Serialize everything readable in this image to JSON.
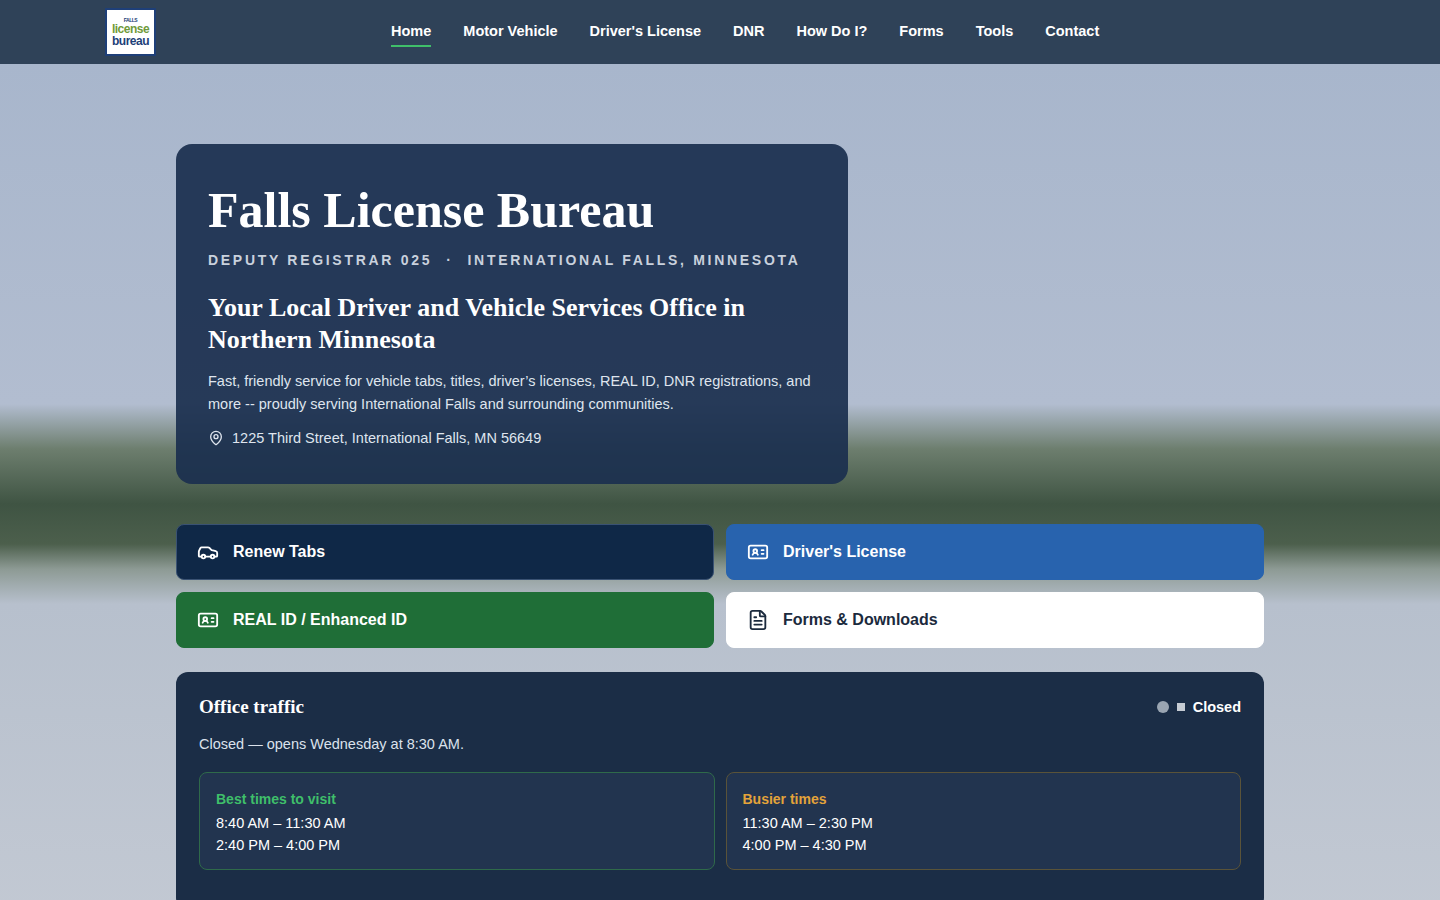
{
  "logo": {
    "lines": [
      "FALLS",
      "license",
      "bureau"
    ]
  },
  "nav": [
    {
      "label": "Home",
      "selected": true
    },
    {
      "label": "Motor Vehicle",
      "selected": false
    },
    {
      "label": "Driver's License",
      "selected": false
    },
    {
      "label": "DNR",
      "selected": false
    },
    {
      "label": "How Do I?",
      "selected": false
    },
    {
      "label": "Forms",
      "selected": false
    },
    {
      "label": "Tools",
      "selected": false
    },
    {
      "label": "Contact",
      "selected": false
    }
  ],
  "hero": {
    "title": "Falls License Bureau",
    "subtitle": [
      "DEPUTY REGISTRAR 025",
      "·",
      "INTERNATIONAL FALLS, MINNESOTA"
    ],
    "heading": "Your Local Driver and Vehicle Services Office in Northern Minnesota",
    "description": "Fast, friendly service for vehicle tabs, titles, driver’s licenses, REAL ID, DNR registrations, and more -- proudly serving International Falls and surrounding communities.",
    "address": "1225 Third Street, International Falls, MN 56649"
  },
  "actions": [
    {
      "label": "Renew Tabs",
      "kind": "dark"
    },
    {
      "label": "Driver's License",
      "kind": "blue"
    },
    {
      "label": "REAL ID / Enhanced ID",
      "kind": "green"
    },
    {
      "label": "Forms & Downloads",
      "kind": "light"
    }
  ],
  "traffic": {
    "title": "Office traffic",
    "status": "Closed",
    "open": false,
    "message": "Closed — opens Wednesday at 8:30 AM.",
    "windows": [
      {
        "label": "Best times to visit",
        "kind": "best",
        "times": [
          "8:40 AM – 11:30 AM",
          "2:40 PM – 4:00 PM"
        ]
      },
      {
        "label": "Busier times",
        "kind": "busy",
        "times": [
          "11:30 AM – 2:30 PM",
          "4:00 PM – 4:30 PM"
        ]
      }
    ]
  }
}
